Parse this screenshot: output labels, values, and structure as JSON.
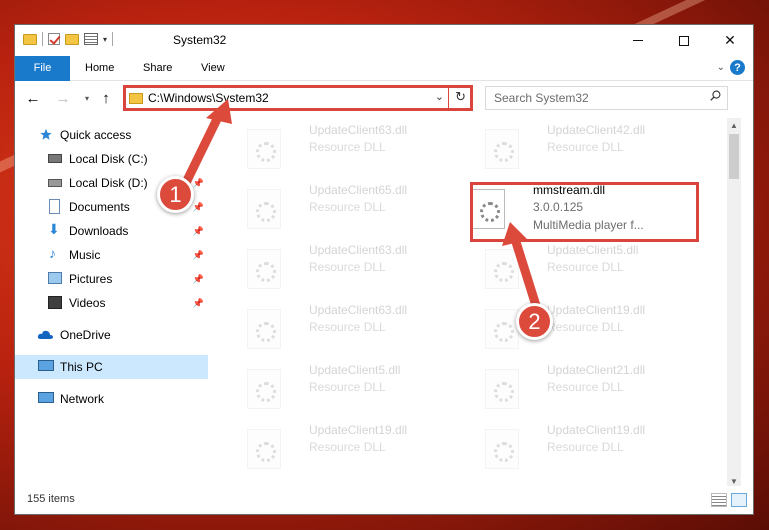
{
  "window": {
    "title": "System32",
    "accent_color": "#1979ca",
    "callout_color": "#dc4a3c"
  },
  "ribbon": {
    "tabs": [
      "File",
      "Home",
      "Share",
      "View"
    ],
    "help_label": "?"
  },
  "address": {
    "path": "C:\\Windows\\System32",
    "search_placeholder": "Search System32"
  },
  "sidebar": {
    "items": [
      {
        "label": "Quick access",
        "icon": "star-icon"
      },
      {
        "label": "Local Disk (C:)",
        "icon": "drive-icon"
      },
      {
        "label": "Local Disk (D:)",
        "icon": "drive-icon",
        "pinned": true
      },
      {
        "label": "Documents",
        "icon": "documents-icon",
        "pinned": true
      },
      {
        "label": "Downloads",
        "icon": "download-icon",
        "pinned": true
      },
      {
        "label": "Music",
        "icon": "music-icon",
        "pinned": true
      },
      {
        "label": "Pictures",
        "icon": "pictures-icon",
        "pinned": true
      },
      {
        "label": "Videos",
        "icon": "video-icon",
        "pinned": true
      },
      {
        "label": "OneDrive",
        "icon": "cloud-icon"
      },
      {
        "label": "This PC",
        "icon": "computer-icon",
        "selected": true
      },
      {
        "label": "Network",
        "icon": "network-icon"
      }
    ]
  },
  "files": {
    "left": [
      {
        "name": "UpdateClient63.dll",
        "desc": "Resource DLL"
      },
      {
        "name": "UpdateClient65.dll",
        "desc": "Resource DLL"
      },
      {
        "name": "UpdateClient63.dll",
        "desc": "Resource DLL"
      },
      {
        "name": "UpdateClient63.dll",
        "desc": "Resource DLL"
      },
      {
        "name": "UpdateClient5.dll",
        "desc": "Resource DLL"
      },
      {
        "name": "UpdateClient19.dll",
        "desc": "Resource DLL"
      }
    ],
    "right": [
      {
        "name": "UpdateClient42.dll",
        "desc": "Resource DLL"
      },
      {
        "name": "UpdateClient5.dll",
        "desc": "Resource DLL"
      },
      {
        "name": "UpdateClient19.dll",
        "desc": "Resource DLL"
      },
      {
        "name": "UpdateClient21.dll",
        "desc": "Resource DLL"
      },
      {
        "name": "UpdateClient19.dll",
        "desc": "Resource DLL"
      }
    ],
    "highlighted": {
      "name": "mmstream.dll",
      "version": "3.0.0.125",
      "desc": "MultiMedia player f..."
    }
  },
  "status": {
    "item_count": "155 items"
  },
  "callouts": [
    "1",
    "2"
  ]
}
